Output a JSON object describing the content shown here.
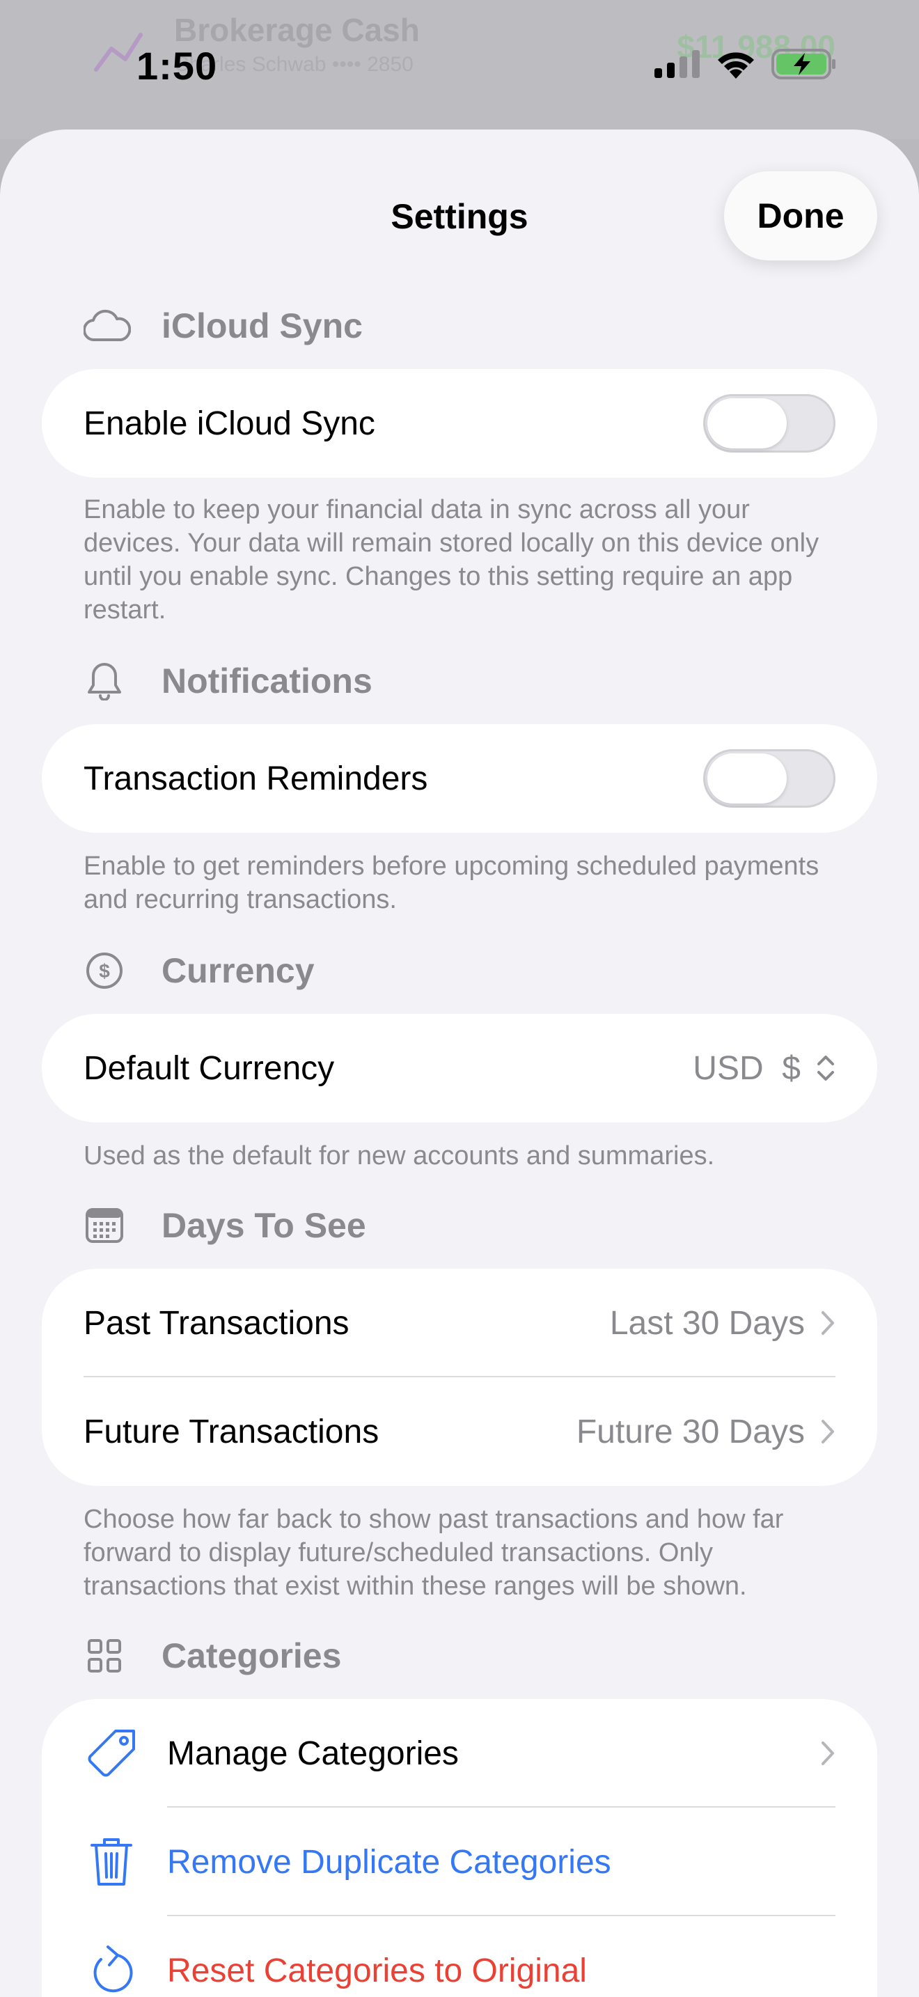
{
  "background": {
    "title": "Brokerage Cash",
    "subtitle": "Charles Schwab •••• 2850",
    "amount": "$11,988.00"
  },
  "status_bar": {
    "time": "1:50",
    "icons": [
      "cellular-signal-icon",
      "wifi-icon",
      "battery-charging-icon"
    ]
  },
  "sheet": {
    "title": "Settings",
    "done_label": "Done"
  },
  "sections": {
    "icloud": {
      "header": "iCloud Sync",
      "icon": "cloud-icon",
      "row_label": "Enable iCloud Sync",
      "toggle_on": false,
      "footer": "Enable to keep your financial data in sync across all your devices. Your data will remain stored locally on this device only until you enable sync. Changes to this setting require an app restart."
    },
    "notifications": {
      "header": "Notifications",
      "icon": "bell-icon",
      "row_label": "Transaction Reminders",
      "toggle_on": false,
      "footer": "Enable to get reminders before upcoming scheduled payments and recurring transactions."
    },
    "currency": {
      "header": "Currency",
      "icon": "dollar-circle-icon",
      "row_label": "Default Currency",
      "value": "USD  $",
      "footer": "Used as the default for new accounts and summaries."
    },
    "days": {
      "header": "Days To See",
      "icon": "calendar-icon",
      "rows": [
        {
          "label": "Past Transactions",
          "value": "Last 30 Days"
        },
        {
          "label": "Future Transactions",
          "value": "Future 30 Days"
        }
      ],
      "footer": "Choose how far back to show past transactions and how far forward to display future/scheduled transactions. Only transactions that exist within these ranges will be shown."
    },
    "categories": {
      "header": "Categories",
      "icon": "grid-icon",
      "rows": [
        {
          "label": "Manage Categories",
          "icon": "tag-icon"
        },
        {
          "label": "Remove Duplicate Categories",
          "icon": "trash-icon"
        },
        {
          "label": "Reset Categories to Original",
          "icon": "reset-icon"
        }
      ]
    }
  },
  "colors": {
    "accent_blue": "#3478f6",
    "destructive_red": "#eb4034",
    "secondary_text": "#8a8a8e",
    "sheet_background": "#f2f2f7",
    "battery_green": "#65c466"
  }
}
